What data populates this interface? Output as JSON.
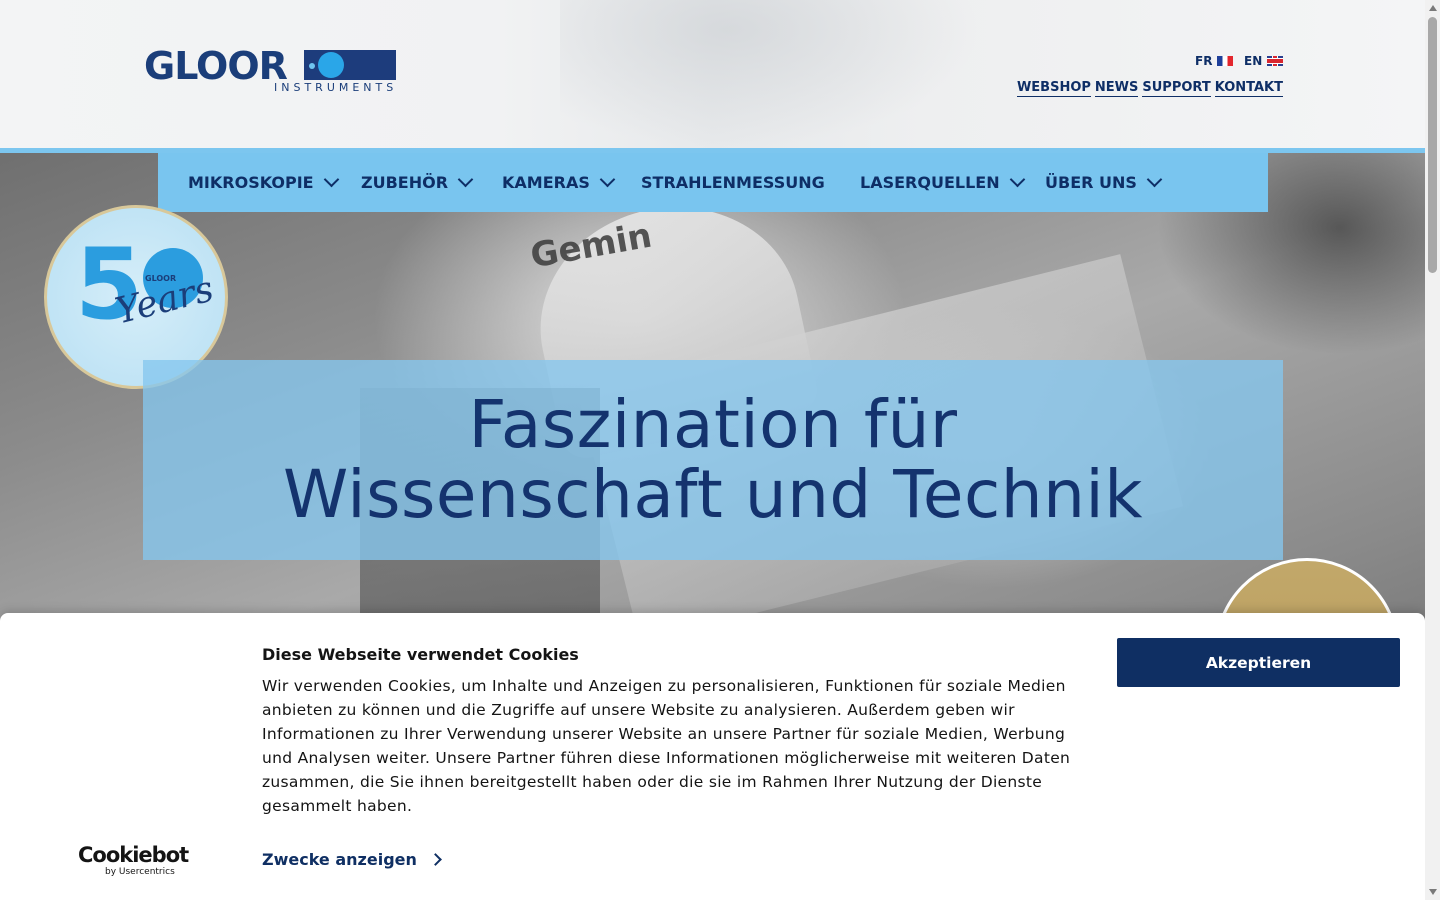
{
  "header": {
    "logo_text": "GLOOR",
    "logo_sub": "INSTRUMENTS",
    "languages": [
      {
        "code": "FR",
        "flag": "flag-fr-icon"
      },
      {
        "code": "EN",
        "flag": "flag-en-icon"
      }
    ],
    "top_links": [
      "WEBSHOP",
      "NEWS",
      "SUPPORT",
      "KONTAKT"
    ]
  },
  "nav": {
    "items": [
      {
        "label": "MIKROSKOPIE",
        "has_dropdown": true
      },
      {
        "label": "ZUBEHÖR",
        "has_dropdown": true
      },
      {
        "label": "KAMERAS",
        "has_dropdown": true
      },
      {
        "label": "STRAHLENMESSUNG",
        "has_dropdown": false
      },
      {
        "label": "LASERQUELLEN",
        "has_dropdown": true
      },
      {
        "label": "ÜBER UNS",
        "has_dropdown": true
      }
    ]
  },
  "hero": {
    "image_text": "Gemin",
    "badge": {
      "number": "5",
      "brand": "GLOOR",
      "years": "Years"
    },
    "headline_line1": "Faszination für",
    "headline_line2": "Wissenschaft und Technik"
  },
  "cookie": {
    "title": "Diese Webseite verwendet Cookies",
    "text": "Wir verwenden Cookies, um Inhalte und Anzeigen zu personalisieren, Funktionen für soziale Medien anbieten zu können und die Zugriffe auf unsere Website zu analysieren. Außerdem geben wir Informationen zu Ihrer Verwendung unserer Website an unsere Partner für soziale Medien, Werbung und Analysen weiter. Unsere Partner führen diese Informationen möglicherweise mit weiteren Daten zusammen, die Sie ihnen bereitgestellt haben oder die sie im Rahmen Ihrer Nutzung der Dienste gesammelt haben.",
    "accept_label": "Akzeptieren",
    "purposes_label": "Zwecke anzeigen",
    "provider": "Cookiebot",
    "provider_sub": "by Usercentrics"
  },
  "colors": {
    "brand_navy": "#0f2f63",
    "nav_blue": "#79c5ef",
    "accent_gold": "#c2a86a"
  }
}
